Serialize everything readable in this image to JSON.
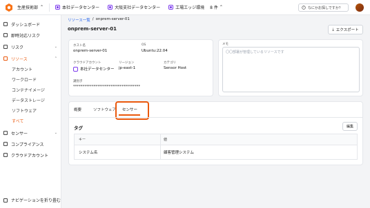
{
  "topbar": {
    "org": "生産技術部",
    "environments": [
      {
        "label": "本社データセンター"
      },
      {
        "label": "大阪支社データセンター"
      },
      {
        "label": "工場エッジ環境"
      }
    ],
    "env_count": "8 件",
    "search_placeholder": "なにかお探しですか？",
    "colors": {
      "accent": "#ea580c",
      "env_icon": "#7c3aed"
    }
  },
  "sidebar": {
    "items": [
      {
        "label": "ダッシュボード",
        "icon": "dashboard-icon"
      },
      {
        "label": "即時対応リスク",
        "icon": "alert-icon"
      },
      {
        "label": "リスク",
        "icon": "warning-icon"
      },
      {
        "label": "リソース",
        "icon": "resource-icon"
      },
      {
        "label": "センサー",
        "icon": "sensor-icon"
      },
      {
        "label": "コンプライアンス",
        "icon": "compliance-icon"
      },
      {
        "label": "クラウドアカウント",
        "icon": "cloud-icon"
      }
    ],
    "sub_items": [
      "アカウント",
      "ワークロード",
      "コンテナイメージ",
      "データストレージ",
      "ソフトウェア",
      "すべて"
    ],
    "collapse_label": "ナビゲーションを折り畳む"
  },
  "breadcrumb": {
    "parent": "リソース一覧",
    "separator": "/",
    "current": "onprem-server-01"
  },
  "page_title": "onprem-server-01",
  "export_label": "エクスポート",
  "details": {
    "hostname_label": "ホスト名",
    "hostname": "onprem-server-01",
    "os_label": "OS",
    "os": "Ubuntu:22.04",
    "cloud_account_label": "クラウドアカウント",
    "cloud_account": "本社データセンター",
    "region_label": "リージョン",
    "region": "jp-east-1",
    "category_label": "カテゴリ",
    "category": "Sensor Host",
    "identifier_label": "識別子",
    "identifier": "************************************"
  },
  "memo": {
    "label": "メモ",
    "placeholder": "〇〇部署が管理しているリソースです"
  },
  "tabs": [
    "概要",
    "ソフトウェア",
    "センサー"
  ],
  "tags": {
    "title": "タグ",
    "edit_label": "編集",
    "headers": [
      "キー",
      "値"
    ],
    "rows": [
      {
        "key": "システム名",
        "value": "顧客管理システム"
      }
    ]
  }
}
